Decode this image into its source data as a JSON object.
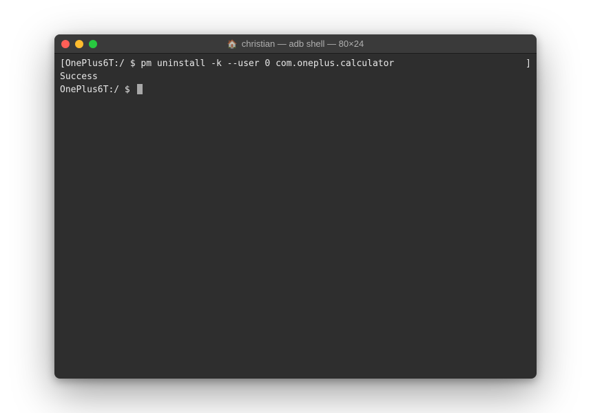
{
  "window": {
    "title": "christian — adb shell — 80×24"
  },
  "terminal": {
    "line1": {
      "bracket_left": "[",
      "content": "OnePlus6T:/ $ pm uninstall -k --user 0 com.oneplus.calculator",
      "bracket_right": "]"
    },
    "line2": "Success",
    "line3": "OnePlus6T:/ $ "
  }
}
